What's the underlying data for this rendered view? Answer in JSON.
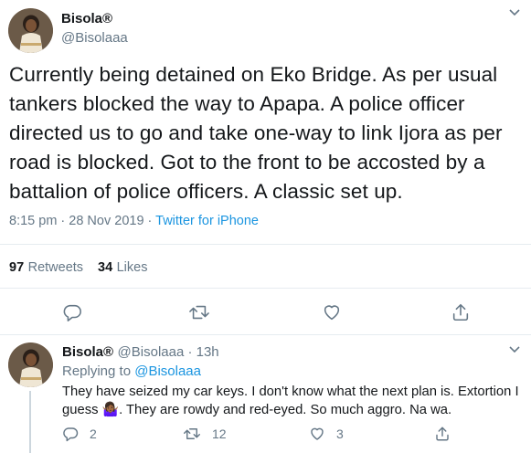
{
  "main_tweet": {
    "author_name": "Bisola®",
    "author_handle": "@Bisolaaa",
    "text": "Currently being detained on Eko Bridge. As per usual tankers blocked the way to Apapa. A police officer directed us to go and take one-way to link Ijora as per road is blocked. Got to the front to be accosted by a battalion of police officers. A classic set up.",
    "time": "8:15 pm · 28 Nov 2019",
    "source": "Twitter for iPhone"
  },
  "stats": {
    "retweets_count": "97",
    "retweets_label": "Retweets",
    "likes_count": "34",
    "likes_label": "Likes"
  },
  "actions": [
    "reply-icon",
    "retweet-icon",
    "like-icon",
    "share-icon"
  ],
  "reply": {
    "author_name": "Bisola®",
    "author_handle": "@Bisolaaa",
    "age": "13h",
    "sub_line": "@Bisolaaa · 13h",
    "replying_label": "Replying to",
    "replying_handle": "@Bisolaaa",
    "text_1": "They have seized my car keys. I don't know what the next plan is. Extortion I",
    "text_2a": "guess",
    "emoji": "🤷🏾‍♀️",
    "text_2b": ". They are rowdy and red-eyed. So much aggro. Na wa.",
    "reply_count": "2",
    "retweet_count": "12",
    "like_count": "3"
  },
  "colors": {
    "link": "#1b95e0",
    "secondary_text": "#657786",
    "divider": "#e6ecf0"
  }
}
